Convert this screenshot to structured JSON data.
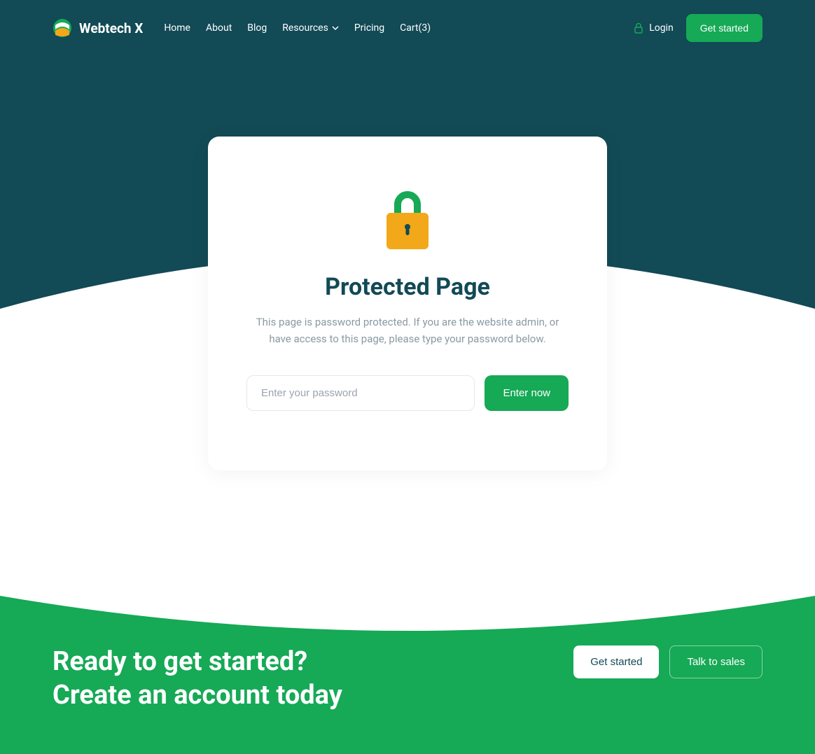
{
  "brand": "Webtech X",
  "nav": {
    "home": "Home",
    "about": "About",
    "blog": "Blog",
    "resources": "Resources",
    "pricing": "Pricing",
    "cart": "Cart(3)"
  },
  "header": {
    "login": "Login",
    "getStarted": "Get started"
  },
  "card": {
    "title": "Protected Page",
    "description": "This page is password protected. If you are the website admin, or have access to this page, please type your password below.",
    "placeholder": "Enter your password",
    "submit": "Enter now"
  },
  "cta": {
    "title": "Ready to get started?",
    "subtitle": "Create an account today",
    "getStarted": "Get started",
    "talkToSales": "Talk to sales"
  },
  "colors": {
    "teal": "#124a56",
    "green": "#16a956",
    "amber": "#f2a818"
  }
}
